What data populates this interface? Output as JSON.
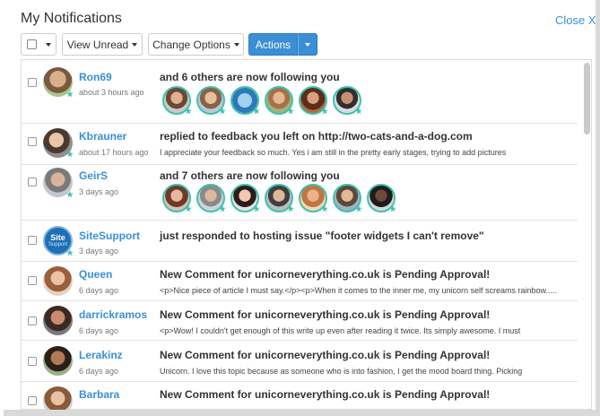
{
  "header": {
    "title": "My Notifications",
    "close_label": "Close X"
  },
  "toolbar": {
    "view_unread_label": "View Unread",
    "change_options_label": "Change Options",
    "actions_label": "Actions"
  },
  "colors": {
    "accent": "#3a8fd6",
    "badge": "#3ec1b0"
  },
  "notifications": [
    {
      "user": "Ron69",
      "time": "about 3 hours ago",
      "headline": "and 6 others are now following you",
      "excerpt": "",
      "follower_count_shown": 6
    },
    {
      "user": "Kbrauner",
      "time": "about 17 hours ago",
      "headline": "replied to feedback you left on http://two-cats-and-a-dog.com",
      "excerpt": "I appreciate your feedback so much. Yes i am still in the pretty early stages, trying to add pictures"
    },
    {
      "user": "GeirS",
      "time": "3 days ago",
      "headline": "and 7 others are now following you",
      "excerpt": "",
      "follower_count_shown": 7
    },
    {
      "user": "SiteSupport",
      "time": "3 days ago",
      "headline": "just responded to hosting issue \"footer widgets I can't remove\"",
      "excerpt": ""
    },
    {
      "user": "Queen",
      "time": "6 days ago",
      "headline": "New Comment for unicorneverything.co.uk is Pending Approval!",
      "excerpt": "<p>Nice piece of article I must say.</p><p>When it comes to the inner me, my unicorn self screams rainbow....."
    },
    {
      "user": "darrickramos",
      "time": "6 days ago",
      "headline": "New Comment for unicorneverything.co.uk is Pending Approval!",
      "excerpt": "<p>Wow! I couldn't get enough of this write up even after reading it twice. Its simply awesome. I must"
    },
    {
      "user": "Lerakinz",
      "time": "6 days ago",
      "headline": "New Comment for unicorneverything.co.uk is Pending Approval!",
      "excerpt": "Unicorn. I love this topic because as someone who is into fashion, I get the mood board thing. Picking"
    },
    {
      "user": "Barbara",
      "time": "",
      "headline": "New Comment for unicorneverything.co.uk is Pending Approval!",
      "excerpt": ""
    }
  ],
  "sitesupport_logo_text": "Site Support"
}
